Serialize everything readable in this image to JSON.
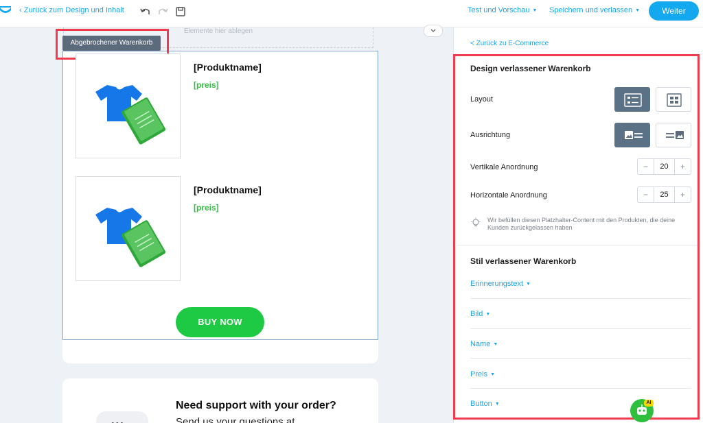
{
  "topbar": {
    "back_label": "Zurück zum Design und Inhalt",
    "test_label": "Test und Vorschau",
    "save_label": "Speichern und verlassen",
    "next_label": "Weiter"
  },
  "canvas": {
    "drop_hint": "Elemente hier ablegen",
    "block_tag": "Abgebrochener Warenkorb",
    "products": [
      {
        "name": "[Produktname]",
        "price": "[preis]"
      },
      {
        "name": "[Produktname]",
        "price": "[preis]"
      }
    ],
    "buy_button": "BUY NOW",
    "support_title": "Need support with your order?",
    "support_sub": "Send us your questions at"
  },
  "panel": {
    "back_label": "< Zurück zu E-Commerce",
    "design_title": "Design verlassener Warenkorb",
    "layout_label": "Layout",
    "align_label": "Ausrichtung",
    "vertical_label": "Vertikale Anordnung",
    "vertical_value": "20",
    "horizontal_label": "Horizontale Anordnung",
    "horizontal_value": "25",
    "hint": "Wir befüllen diesen Platzhalter-Content mit den Produkten, die deine Kunden zurückgelassen haben",
    "style_title": "Stil verlassener Warenkorb",
    "sections": [
      "Erinnerungstext",
      "Bild",
      "Name",
      "Preis",
      "Button"
    ],
    "ai_badge": "AI"
  },
  "colors": {
    "accent": "#14a8ef",
    "highlight": "#ee3b4d",
    "buy_green": "#1ec944",
    "active_option": "#5b7186"
  }
}
